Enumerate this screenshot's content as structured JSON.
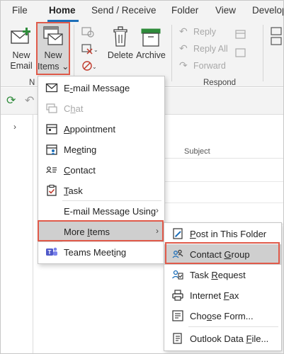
{
  "tabs": [
    "File",
    "Home",
    "Send / Receive",
    "Folder",
    "View",
    "Develop"
  ],
  "ribbon": {
    "new_email": [
      "New",
      "Email"
    ],
    "new_items": [
      "New",
      "Items"
    ],
    "delete": "Delete",
    "archive": "Archive",
    "reply": "Reply",
    "reply_all": "Reply All",
    "forward": "Forward",
    "group_new_fragment": "N",
    "group_respond": "Respond"
  },
  "list_header": {
    "subject": "Subject"
  },
  "new_items_menu": [
    {
      "label": "E-mail Message",
      "mnemonic": 1,
      "icon": "envelope-icon",
      "disabled": false
    },
    {
      "label": "Chat",
      "mnemonic": 1,
      "icon": "chat-icon",
      "disabled": true
    },
    {
      "label": "Appointment",
      "mnemonic": 0,
      "icon": "calendar-icon",
      "disabled": false
    },
    {
      "label": "Meeting",
      "mnemonic": 2,
      "icon": "meeting-icon",
      "disabled": false
    },
    {
      "label": "Contact",
      "mnemonic": 0,
      "icon": "contact-card-icon",
      "disabled": false
    },
    {
      "label": "Task",
      "mnemonic": 0,
      "icon": "task-icon",
      "disabled": false
    },
    {
      "label": "E-mail Message Using",
      "mnemonic": 12,
      "icon": "",
      "disabled": false,
      "submenu": true
    },
    {
      "label": "More Items",
      "mnemonic": 5,
      "icon": "",
      "disabled": false,
      "submenu": true,
      "selected": true
    },
    {
      "label": "Teams Meeting",
      "mnemonic": 10,
      "icon": "teams-icon",
      "disabled": false
    }
  ],
  "more_items_menu": [
    {
      "label": "Post in This Folder",
      "mnemonic": 0,
      "icon": "post-icon"
    },
    {
      "label": "Contact Group",
      "mnemonic": 8,
      "icon": "contact-group-icon",
      "selected": true
    },
    {
      "label": "Task Request",
      "mnemonic": 5,
      "icon": "task-request-icon"
    },
    {
      "label": "Internet Fax",
      "mnemonic": 9,
      "icon": "fax-icon"
    },
    {
      "label": "Choose Form...",
      "mnemonic": 3,
      "icon": "form-icon"
    },
    {
      "label": "Outlook Data File...",
      "mnemonic": 13,
      "icon": "data-file-icon"
    }
  ],
  "colors": {
    "accent": "#1e6fb8",
    "highlight_border": "#e05a4a",
    "selected_bg": "#cfcfcf",
    "green": "#2e8b3a"
  }
}
